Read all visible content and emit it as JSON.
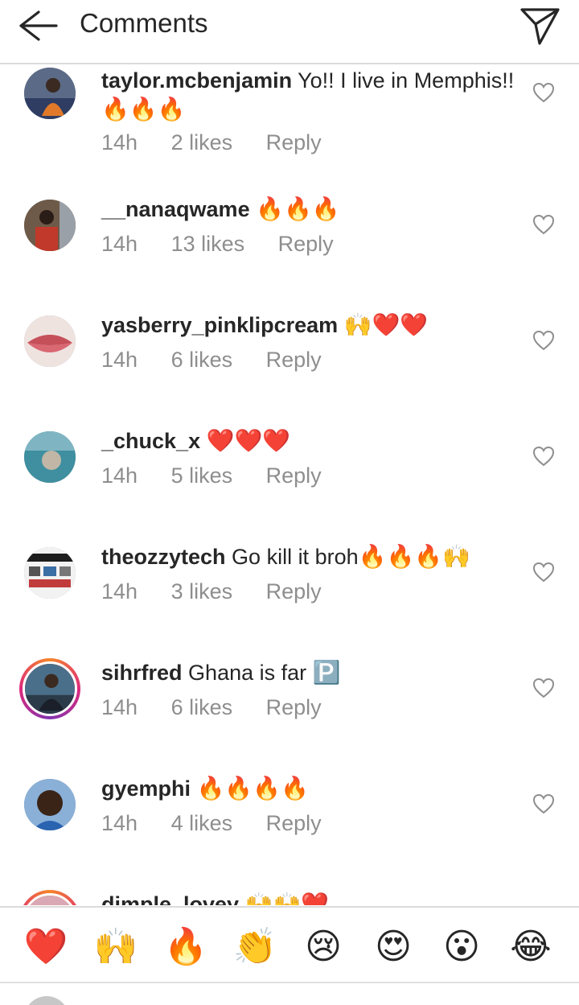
{
  "header": {
    "title": "Comments"
  },
  "comments": [
    {
      "username": "taylor.mcbenjamin",
      "text": "Yo!! I live in Memphis!!",
      "emoji": "🔥🔥🔥",
      "time": "14h",
      "likes": "2 likes",
      "reply": "Reply"
    },
    {
      "username": "__nanaqwame",
      "text": "",
      "emoji": "🔥🔥🔥",
      "time": "14h",
      "likes": "13 likes",
      "reply": "Reply"
    },
    {
      "username": "yasberry_pinklipcream",
      "text": "",
      "emoji": "🙌❤️❤️",
      "time": "14h",
      "likes": "6 likes",
      "reply": "Reply"
    },
    {
      "username": "_chuck_x",
      "text": "",
      "emoji": "❤️❤️❤️",
      "time": "14h",
      "likes": "5 likes",
      "reply": "Reply"
    },
    {
      "username": "theozzytech",
      "text": "Go kill it broh",
      "emoji": "🔥🔥🔥🙌",
      "time": "14h",
      "likes": "3 likes",
      "reply": "Reply"
    },
    {
      "username": "sihrfred",
      "text": "Ghana is far",
      "emoji": "🅿️",
      "time": "14h",
      "likes": "6 likes",
      "reply": "Reply"
    },
    {
      "username": "gyemphi",
      "text": "",
      "emoji": "🔥🔥🔥🔥",
      "time": "14h",
      "likes": "4 likes",
      "reply": "Reply"
    },
    {
      "username": "dimple_lovey",
      "text": "",
      "emoji": "🙌🙌❤️",
      "time": "",
      "likes": "",
      "reply": ""
    }
  ],
  "reactions": [
    "❤️",
    "🙌",
    "🔥",
    "👏",
    "😢",
    "😍",
    "😮",
    "😂"
  ],
  "icons": {
    "back": "arrow-left-icon",
    "send": "paper-plane-icon",
    "like": "heart-outline-icon"
  },
  "colors": {
    "text": "#262626",
    "meta": "#8e8e8e",
    "divider": "#dbdbdb"
  }
}
